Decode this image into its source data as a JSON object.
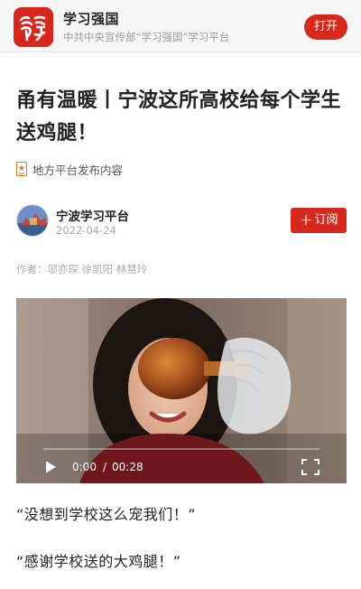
{
  "banner": {
    "app_name": "学习强国",
    "app_subtitle": "中共中央宣传部“学习强国”学习平台",
    "open_label": "打开",
    "logo_text": "学习",
    "accent": "#d7281e"
  },
  "article": {
    "title": "甬有温暖丨宁波这所高校给每个学生送鸡腿！",
    "source_label": "地方平台发布内容",
    "author": {
      "name": "宁波学习平台",
      "date": "2022-04-24",
      "subscribe_label": "订阅"
    },
    "authors_line": "作者：邬亦琛 徐凯阳 林慧玲",
    "video": {
      "current_time": "0:00",
      "separator": "/",
      "total_time": "00:28",
      "progress": 0
    },
    "paragraphs": [
      "“没想到学校这么宠我们！”",
      "“感谢学校送的大鸡腿！”"
    ]
  },
  "icons": {
    "play": "play-icon",
    "fullscreen": "fullscreen-icon",
    "source": "medal-icon",
    "plus": "plus-icon"
  }
}
